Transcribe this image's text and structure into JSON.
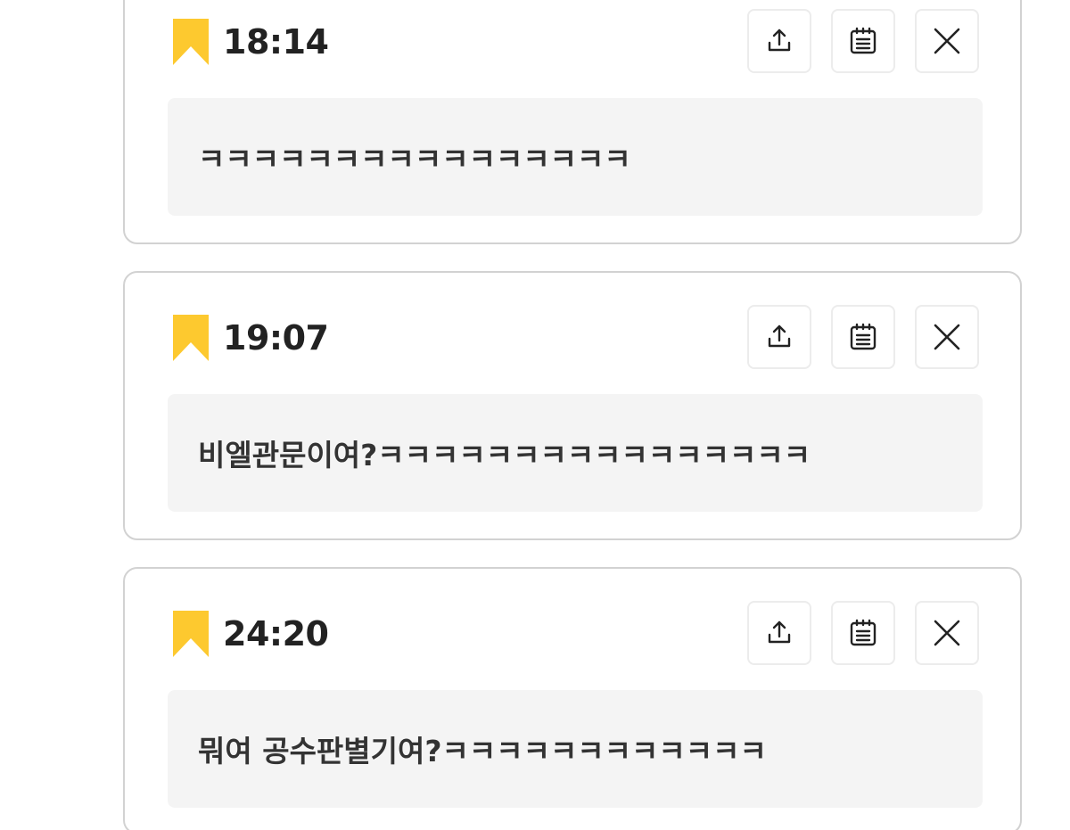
{
  "colors": {
    "bookmark": "#FDC92F",
    "card_border": "#d2d2d2",
    "message_bg": "#f4f4f4",
    "text": "#222222"
  },
  "icons": {
    "bookmark": "bookmark-icon",
    "share": "share-icon",
    "memo": "notepad-icon",
    "close": "close-icon"
  },
  "bookmarks": [
    {
      "time": "18:14",
      "message": "ㅋㅋㅋㅋㅋㅋㅋㅋㅋㅋㅋㅋㅋㅋㅋㅋ"
    },
    {
      "time": "19:07",
      "message": "비엘관문이여?ㅋㅋㅋㅋㅋㅋㅋㅋㅋㅋㅋㅋㅋㅋㅋㅋ"
    },
    {
      "time": "24:20",
      "message": "뭐여 공수판별기여?ㅋㅋㅋㅋㅋㅋㅋㅋㅋㅋㅋㅋ"
    }
  ]
}
